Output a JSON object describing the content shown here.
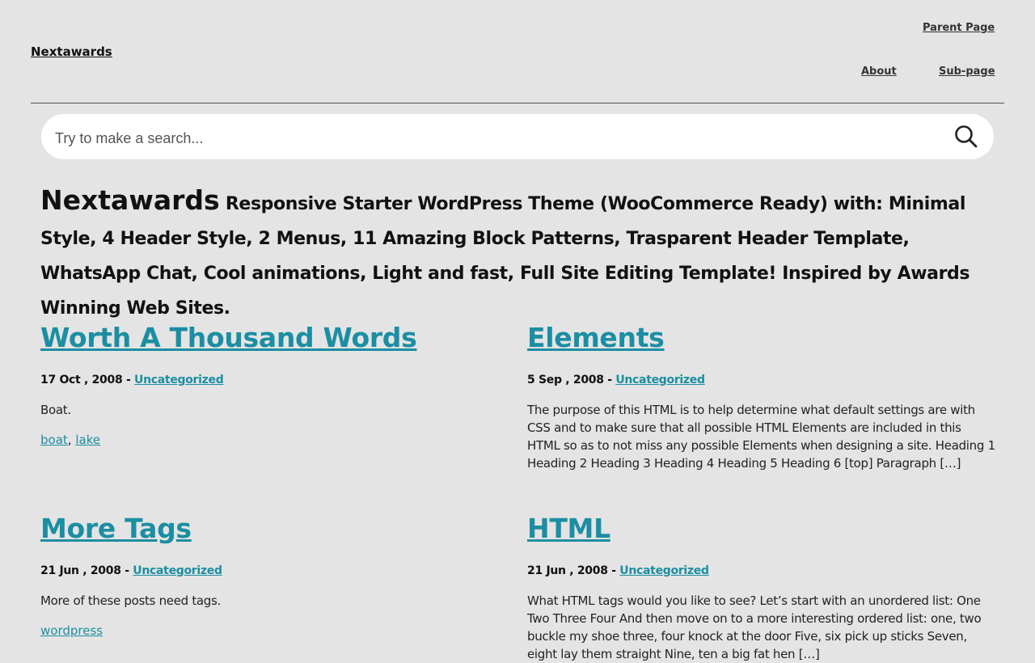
{
  "header": {
    "site_title": "Nextawards",
    "nav": {
      "parent_page": "Parent Page",
      "about": "About",
      "sub_page": "Sub-page"
    }
  },
  "search": {
    "placeholder": "Try to make a search...",
    "icon": "search-icon"
  },
  "intro": {
    "brand": "Nextawards",
    "text": "Responsive Starter WordPress Theme (WooCommerce Ready) with: Minimal Style, 4 Header Style, 2 Menus, 11 Amazing Block Patterns, Trasparent Header Template, WhatsApp Chat, Cool animations, Light and fast, Full Site Editing Template! Inspired by Awards Winning Web Sites."
  },
  "posts": [
    {
      "title": "Worth A Thousand Words",
      "date": "17 Oct , 2008 -",
      "category": "Uncategorized",
      "excerpt": "Boat.",
      "tags": [
        "boat",
        "lake"
      ],
      "tag_separator": ","
    },
    {
      "title": "Elements",
      "date": "5 Sep , 2008 -",
      "category": "Uncategorized",
      "excerpt": "The purpose of this HTML is to help determine what default settings are with CSS and to make sure that all possible HTML Elements are included in this HTML so as to not miss any possible Elements when designing a site. Heading 1 Heading 2 Heading 3 Heading 4 Heading 5 Heading 6 [top] Paragraph […]"
    },
    {
      "title": "More Tags",
      "date": "21 Jun , 2008 -",
      "category": "Uncategorized",
      "excerpt": "More of these posts need tags.",
      "tags": [
        "wordpress"
      ]
    },
    {
      "title": "HTML",
      "date": "21 Jun , 2008 -",
      "category": "Uncategorized",
      "excerpt": "What HTML tags would you like to see? Let’s start with an unordered list: One Two Three Four And then move on to a more interesting ordered list: one, two buckle my shoe three, four knock at the door Five, six pick up sticks Seven, eight lay them straight Nine, ten a big fat hen […]"
    }
  ],
  "colors": {
    "background": "#e4e4e4",
    "link": "#1b8ea3",
    "text": "#111111"
  }
}
